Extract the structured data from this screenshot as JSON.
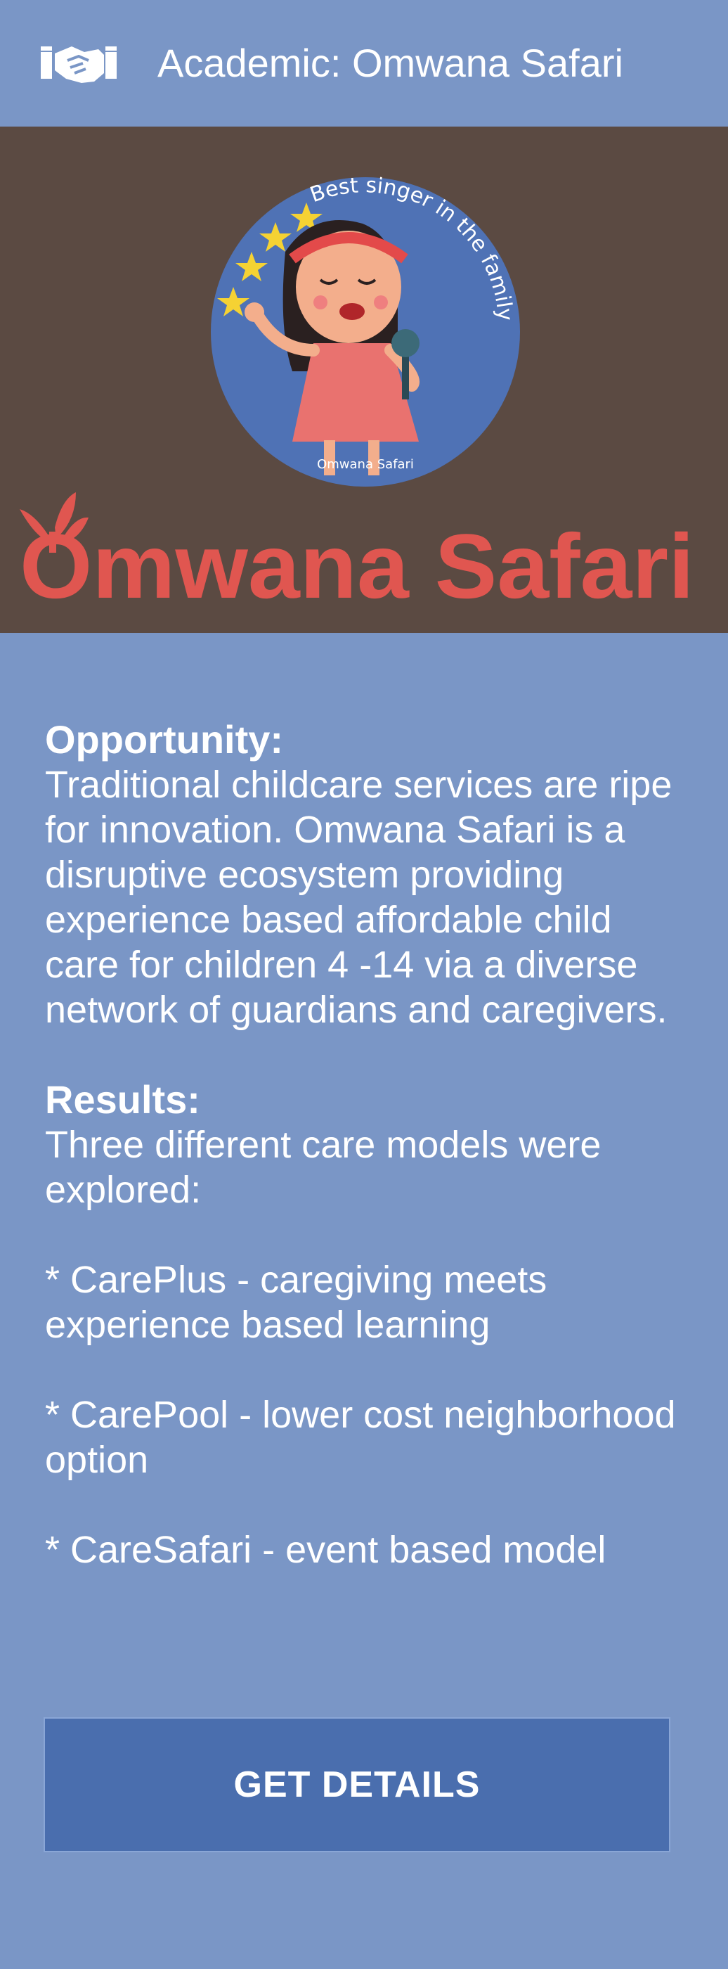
{
  "header": {
    "title": "Academic: Omwana Safari",
    "logo_icon": "handshake-icon"
  },
  "hero": {
    "badge_caption": "Best singer in the family",
    "badge_label": "Omwana Safari",
    "brand_name": "Omwana Safari",
    "brand_color": "#e05650",
    "background_color": "#5b4a42"
  },
  "opportunity": {
    "heading": "Opportunity:",
    "text": "Traditional childcare services are ripe for innovation. Omwana Safari is a disruptive ecosystem providing experience based affordable child care for children 4 -14 via a diverse network of guardians and caregivers."
  },
  "results": {
    "heading": "Results:",
    "intro": "Three different care models were explored:",
    "items": [
      "* CarePlus - caregiving meets experience based learning",
      "* CarePool - lower cost neighborhood option",
      "* CareSafari - event based model"
    ]
  },
  "cta": {
    "label": "GET DETAILS"
  },
  "colors": {
    "page_background": "#7a96c6",
    "button_background": "#4a6eae"
  }
}
